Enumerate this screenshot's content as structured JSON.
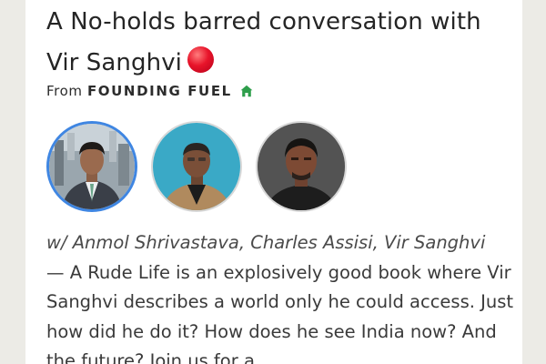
{
  "post": {
    "title": "A No-holds barred conversation with Vir Sanghvi",
    "title_emoji": "red-circle",
    "from_prefix": "From",
    "publication": "FOUNDING FUEL",
    "publication_icon": "house-icon",
    "accent_color": "#2e9e4b"
  },
  "speakers": [
    {
      "avatar": "avatar-anmol-shrivastava",
      "ring_color": "#3f86e2"
    },
    {
      "avatar": "avatar-charles-assisi"
    },
    {
      "avatar": "avatar-vir-sanghvi"
    }
  ],
  "description": {
    "guests": "w/ Anmol Shrivastava, Charles Assisi, Vir Sanghvi",
    "text": "— A Rude Life is an explosively good book where Vir Sanghvi describes a world only he could access. Just how did he do it? How does he see India now? And the future? Join us for a"
  }
}
